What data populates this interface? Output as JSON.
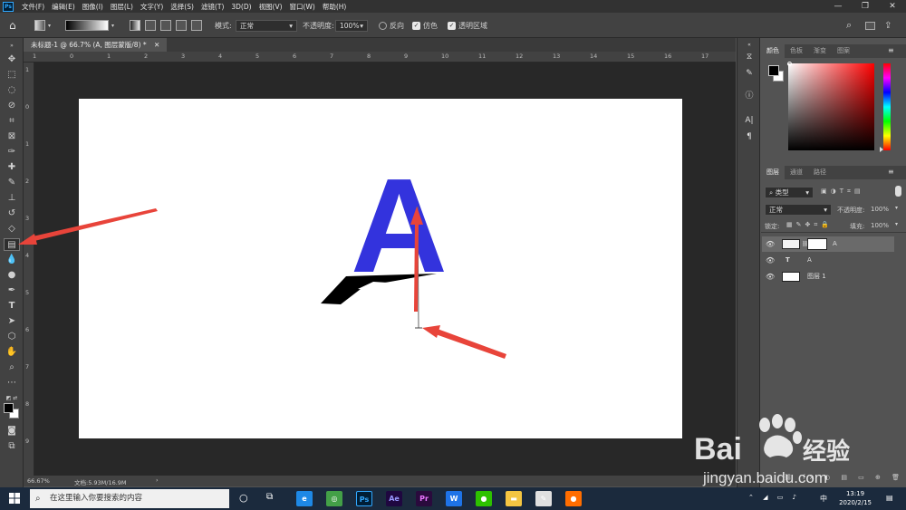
{
  "app": {
    "logo": "Ps"
  },
  "menu": [
    "文件(F)",
    "编辑(E)",
    "图像(I)",
    "图层(L)",
    "文字(Y)",
    "选择(S)",
    "滤镜(T)",
    "3D(D)",
    "视图(V)",
    "窗口(W)",
    "帮助(H)"
  ],
  "options": {
    "mode_label": "模式:",
    "mode_value": "正常",
    "opacity_label": "不透明度:",
    "opacity_value": "100%",
    "reverse_label": "反向",
    "dither_label": "仿色",
    "transparency_label": "透明区域"
  },
  "document": {
    "tab_title": "未标题-1 @ 66.7% (A, 图层蒙版/8) *",
    "letter": "A",
    "letter_color": "#3333dd"
  },
  "ruler_top": [
    "1",
    "0",
    "1",
    "2",
    "3",
    "4",
    "5",
    "6",
    "7",
    "8",
    "9",
    "10",
    "11",
    "12",
    "13",
    "14",
    "15",
    "16",
    "17"
  ],
  "ruler_left": [
    "1",
    "0",
    "1",
    "2",
    "3",
    "4",
    "5",
    "6",
    "7",
    "8",
    "9"
  ],
  "status": {
    "zoom": "66.67%",
    "doc": "文档:5.93M/16.9M"
  },
  "color_panel": {
    "tabs": [
      "颜色",
      "色板",
      "渐变",
      "图案"
    ]
  },
  "layers_panel": {
    "tabs": [
      "图层",
      "通道",
      "路径"
    ],
    "kind_filter": "类型",
    "blend_mode": "正常",
    "opacity_label": "不透明度:",
    "opacity_value": "100%",
    "lock_label": "锁定:",
    "fill_label": "填充:",
    "fill_value": "100%",
    "layers": [
      {
        "name": "A",
        "type": "masked"
      },
      {
        "name": "A",
        "type": "text"
      },
      {
        "name": "图层 1",
        "type": "pixel"
      }
    ]
  },
  "taskbar": {
    "search_placeholder": "在这里输入你要搜索的内容",
    "time": "13:19",
    "date": "2020/2/15",
    "ime": "中",
    "apps": [
      {
        "name": "edge",
        "label": "e",
        "color": "#1e88e5"
      },
      {
        "name": "360",
        "label": "◎",
        "color": "#43a047"
      },
      {
        "name": "photoshop",
        "label": "Ps",
        "color": "#001e36"
      },
      {
        "name": "after-effects",
        "label": "Ae",
        "color": "#1f0740"
      },
      {
        "name": "premiere",
        "label": "Pr",
        "color": "#2a0a3d"
      },
      {
        "name": "wps",
        "label": "W",
        "color": "#1e73e8"
      },
      {
        "name": "wechat",
        "label": "●",
        "color": "#2dc100"
      },
      {
        "name": "explorer",
        "label": "▬",
        "color": "#f4c542"
      },
      {
        "name": "feather",
        "label": "✎",
        "color": "#e0e0e0"
      },
      {
        "name": "firefox",
        "label": "●",
        "color": "#ff6d00"
      }
    ]
  },
  "watermark": {
    "brand": "Bai",
    "brand2": "经验",
    "url": "jingyan.baidu.com"
  }
}
